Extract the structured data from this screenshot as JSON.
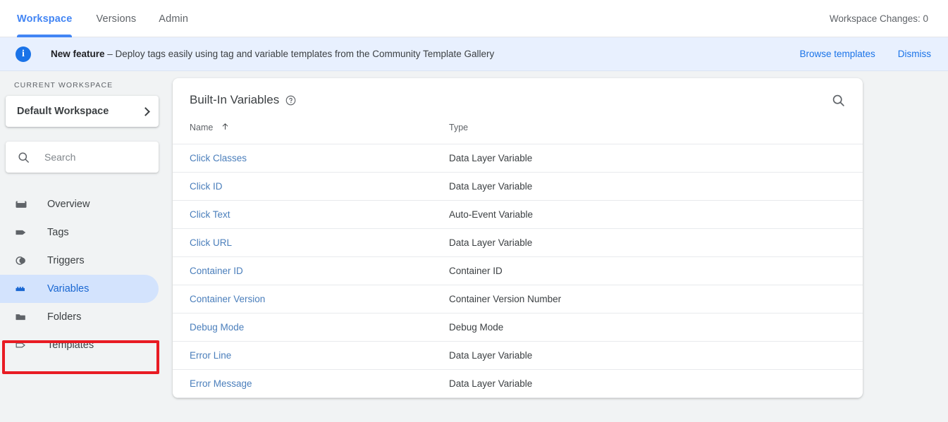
{
  "topbar": {
    "tabs": [
      {
        "label": "Workspace",
        "active": true
      },
      {
        "label": "Versions",
        "active": false
      },
      {
        "label": "Admin",
        "active": false
      }
    ],
    "workspace_changes": "Workspace Changes: 0",
    "active_color": "#4285f4"
  },
  "banner": {
    "icon": "info-icon",
    "title": "New feature",
    "dash": " – ",
    "message": "Deploy tags easily using tag and variable templates from the Community Template Gallery",
    "browse_label": "Browse templates",
    "dismiss_label": "Dismiss",
    "bg_color": "#e8f0fe",
    "link_color": "#1a73e8"
  },
  "sidebar": {
    "caption": "CURRENT WORKSPACE",
    "workspace_name": "Default Workspace",
    "search_placeholder": "Search",
    "search_value": "",
    "items": [
      {
        "label": "Overview",
        "icon": "overview-icon",
        "active": false
      },
      {
        "label": "Tags",
        "icon": "tag-icon",
        "active": false
      },
      {
        "label": "Triggers",
        "icon": "trigger-icon",
        "active": false
      },
      {
        "label": "Variables",
        "icon": "variables-icon",
        "active": true
      },
      {
        "label": "Folders",
        "icon": "folder-icon",
        "active": false
      },
      {
        "label": "Templates",
        "icon": "template-icon",
        "active": false
      }
    ],
    "active_bg": "#d3e3fd",
    "active_text": "#1967d2",
    "annotation_color": "#e81b23"
  },
  "main": {
    "card_title": "Built-In Variables",
    "help_icon": "help-circle-icon",
    "search_icon": "search-icon",
    "columns": {
      "name": "Name",
      "type": "Type",
      "sort": "ascending"
    },
    "rows": [
      {
        "name": "Click Classes",
        "type": "Data Layer Variable"
      },
      {
        "name": "Click ID",
        "type": "Data Layer Variable"
      },
      {
        "name": "Click Text",
        "type": "Auto-Event Variable"
      },
      {
        "name": "Click URL",
        "type": "Data Layer Variable"
      },
      {
        "name": "Container ID",
        "type": "Container ID"
      },
      {
        "name": "Container Version",
        "type": "Container Version Number"
      },
      {
        "name": "Debug Mode",
        "type": "Debug Mode"
      },
      {
        "name": "Error Line",
        "type": "Data Layer Variable"
      },
      {
        "name": "Error Message",
        "type": "Data Layer Variable"
      }
    ],
    "link_color": "#4a7ebb"
  }
}
